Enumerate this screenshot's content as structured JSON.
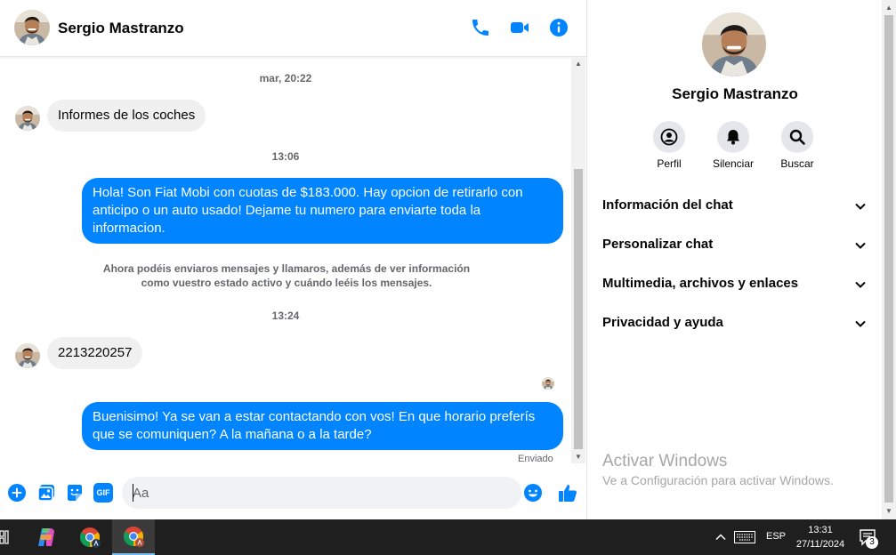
{
  "chat": {
    "contact_name": "Sergio Mastranzo",
    "messages": [
      {
        "type": "timestamp",
        "text": "mar, 20:22"
      },
      {
        "type": "incoming",
        "text": "Informes de los coches"
      },
      {
        "type": "timestamp",
        "text": "13:06"
      },
      {
        "type": "outgoing",
        "text": "Hola! Son Fiat Mobi con cuotas de $183.000. Hay opcion de retirarlo con anticipo o un auto usado! Dejame tu numero para enviarte toda la informacion."
      },
      {
        "type": "system",
        "text": "Ahora podéis enviaros mensajes y llamaros, además de ver información como vuestro estado activo y cuándo leéis los mensajes."
      },
      {
        "type": "timestamp",
        "text": "13:24"
      },
      {
        "type": "incoming",
        "text": "2213220257"
      },
      {
        "type": "outgoing",
        "text": "Buenisimo! Ya se van a estar contactando con vos! En que horario preferís que se comuniquen? A la mañana o a la tarde?"
      }
    ],
    "status": "Enviado",
    "composer": {
      "placeholder": "Aa",
      "gif_label": "GIF"
    }
  },
  "info_panel": {
    "name": "Sergio Mastranzo",
    "actions": [
      {
        "label": "Perfil",
        "icon": "profile-icon"
      },
      {
        "label": "Silenciar",
        "icon": "bell-icon"
      },
      {
        "label": "Buscar",
        "icon": "search-icon"
      }
    ],
    "sections": [
      {
        "label": "Información del chat"
      },
      {
        "label": "Personalizar chat"
      },
      {
        "label": "Multimedia, archivos y enlaces"
      },
      {
        "label": "Privacidad y ayuda"
      }
    ],
    "watermark": {
      "title": "Activar Windows",
      "subtitle": "Ve a Configuración para activar Windows."
    }
  },
  "taskbar": {
    "language": "ESP",
    "time": "13:31",
    "date": "27/11/2024",
    "notifications": "3"
  },
  "colors": {
    "accent": "#0084ff",
    "incoming_bubble": "#f0f0f0",
    "taskbar": "#1f1f1f"
  }
}
